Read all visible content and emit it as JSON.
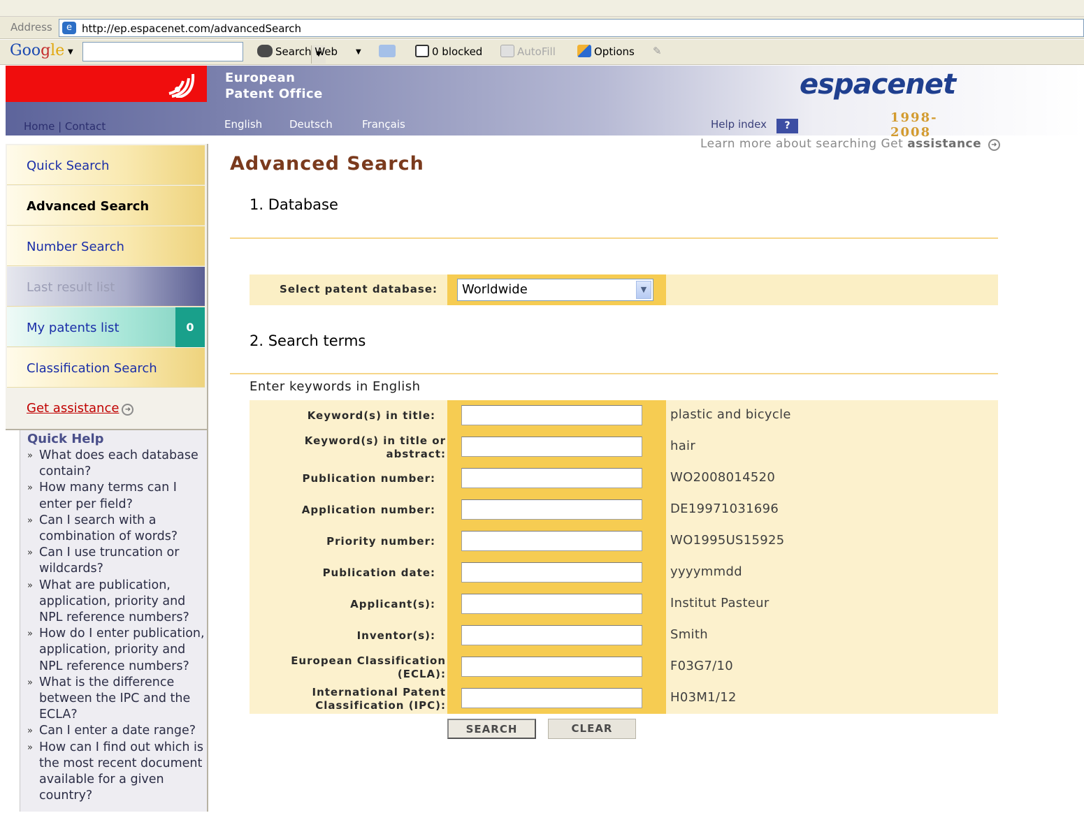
{
  "browser": {
    "address_label": "Address",
    "url": "http://ep.espacenet.com/advancedSearch",
    "google_logo_parts": [
      "Goo",
      "g",
      "le"
    ],
    "toolbar": {
      "search_web": "Search Web",
      "blocked": "0 blocked",
      "autofill": "AutoFill",
      "options": "Options"
    }
  },
  "header": {
    "org_line1": "European",
    "org_line2": "Patent Office",
    "home": "Home",
    "separator": " | ",
    "contact": "Contact",
    "languages": [
      "English",
      "Deutsch",
      "Français"
    ],
    "help_index": "Help index",
    "help_icon": "?",
    "brand_word": "espacenet",
    "brand_years": "1998-2008"
  },
  "sidebar": {
    "nav": [
      {
        "label": "Quick Search"
      },
      {
        "label": "Advanced Search"
      },
      {
        "label": "Number Search"
      },
      {
        "label": "Last result list"
      },
      {
        "label": "My patents list",
        "count": "0"
      },
      {
        "label": "Classification Search"
      }
    ],
    "get_assistance": "Get assistance",
    "quick_help": {
      "title": "Quick Help",
      "items": [
        "What does each database contain?",
        "How many terms can I enter per field?",
        "Can I search with a combination of words?",
        "Can I use truncation or wildcards?",
        "What are publication, application, priority and NPL reference numbers?",
        "How do I enter publication, application, priority and NPL reference numbers?",
        "What is the difference between the IPC and the ECLA?",
        "Can I enter a date range?",
        "How can I find out which is the most recent document available for a given country?"
      ]
    }
  },
  "main": {
    "title": "Advanced Search",
    "learn_more_prefix": "Learn more about searching Get ",
    "learn_more_bold": "assistance",
    "section1": "1. Database",
    "db_label": "Select patent database:",
    "db_value": "Worldwide",
    "section2": "2. Search terms",
    "enter_keywords": "Enter keywords in English",
    "fields": [
      {
        "label": "Keyword(s) in title:",
        "value": "",
        "example": "plastic and bicycle"
      },
      {
        "label": "Keyword(s) in title or abstract:",
        "value": "",
        "example": "hair"
      },
      {
        "label": "Publication number:",
        "value": "",
        "example": "WO2008014520"
      },
      {
        "label": "Application number:",
        "value": "",
        "example": "DE19971031696"
      },
      {
        "label": "Priority number:",
        "value": "",
        "example": "WO1995US15925"
      },
      {
        "label": "Publication date:",
        "value": "",
        "example": "yyyymmdd"
      },
      {
        "label": "Applicant(s):",
        "value": "",
        "example": "Institut Pasteur"
      },
      {
        "label": "Inventor(s):",
        "value": "",
        "example": "Smith"
      },
      {
        "label": "European Classification (ECLA):",
        "value": "",
        "example": "F03G7/10"
      },
      {
        "label": "International Patent Classification (IPC):",
        "value": "",
        "example": "H03M1/12"
      }
    ],
    "search_button": "SEARCH",
    "clear_button": "CLEAR"
  }
}
